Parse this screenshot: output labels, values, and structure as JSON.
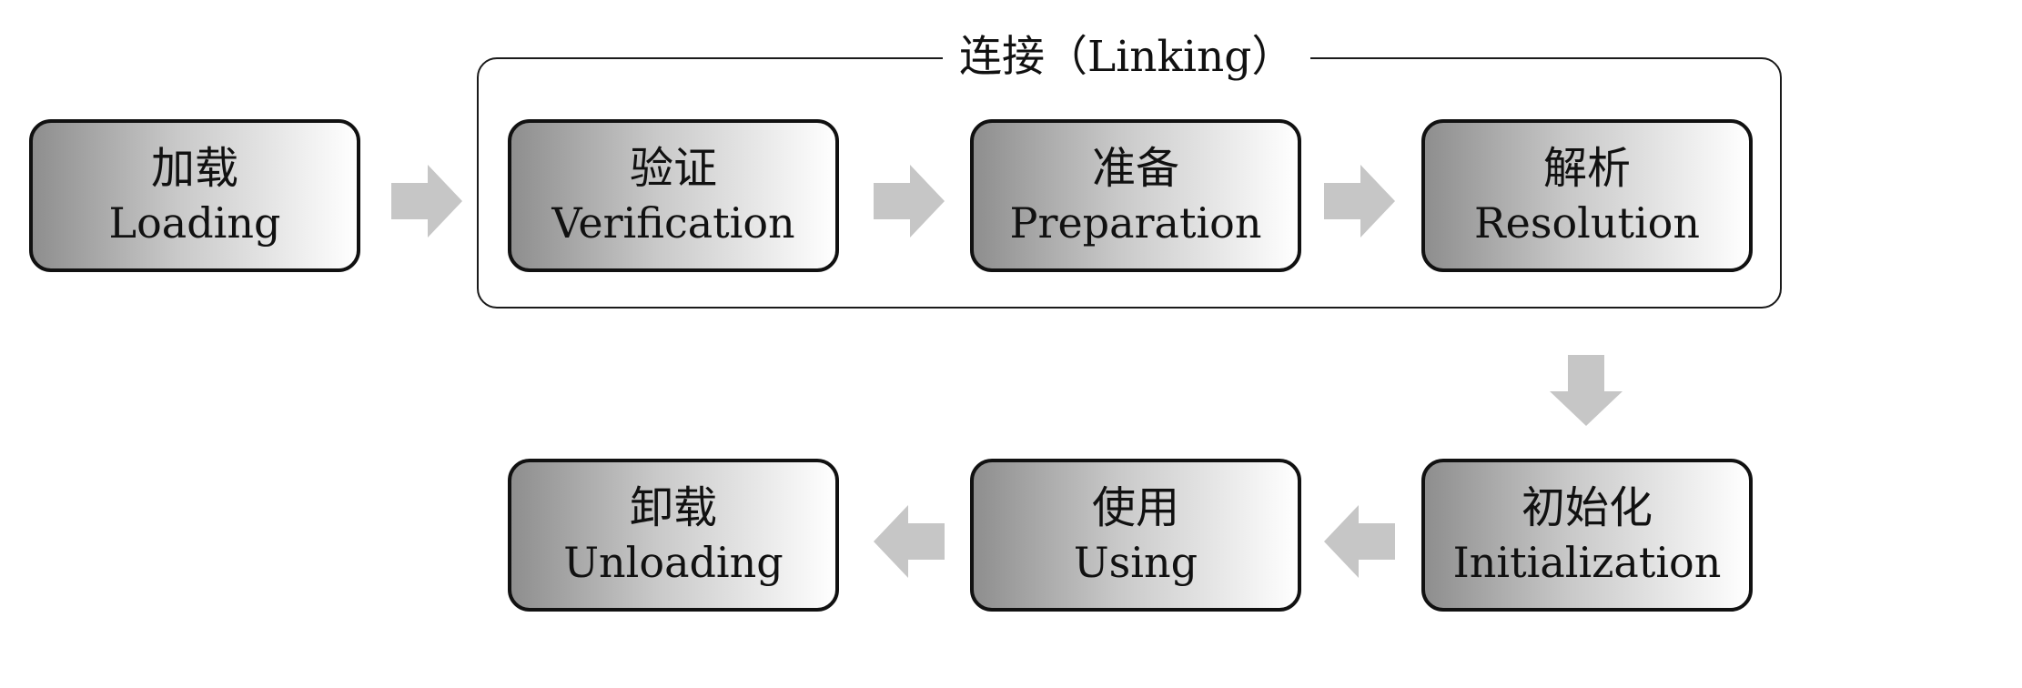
{
  "linking_group": {
    "title": "连接（Linking）"
  },
  "stages": {
    "loading": {
      "zh": "加载",
      "en": "Loading"
    },
    "verification": {
      "zh": "验证",
      "en": "Verification"
    },
    "preparation": {
      "zh": "准备",
      "en": "Preparation"
    },
    "resolution": {
      "zh": "解析",
      "en": "Resolution"
    },
    "initialization": {
      "zh": "初始化",
      "en": "Initialization"
    },
    "using": {
      "zh": "使用",
      "en": "Using"
    },
    "unloading": {
      "zh": "卸载",
      "en": "Unloading"
    }
  },
  "colors": {
    "arrow": "#c6c6c6",
    "box_border": "#111111",
    "gradient_dark": "#8e8e8e",
    "gradient_light": "#ffffff"
  },
  "icons": {
    "flow_arrow": "block-arrow-icon"
  }
}
